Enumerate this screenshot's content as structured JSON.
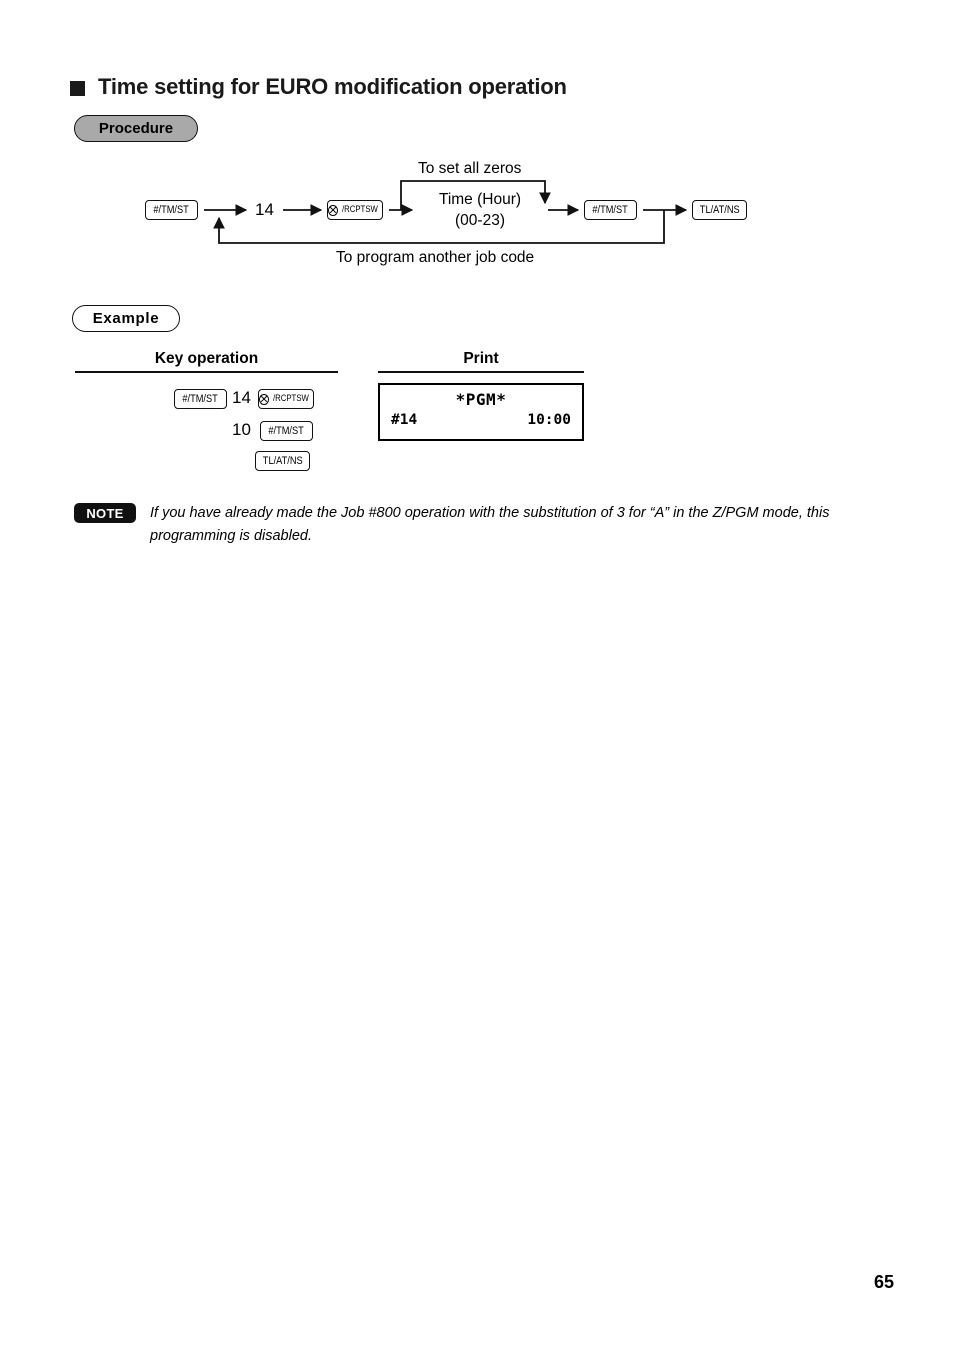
{
  "page": {
    "number": "65"
  },
  "section": {
    "title": "Time setting for EURO modification operation"
  },
  "badges": {
    "procedure": "Procedure",
    "example": "Example",
    "note": "NOTE"
  },
  "procedure_diagram": {
    "keys": {
      "hash_tm_st_1": "#/TM/ST",
      "rcptsw": "/RCPTSW",
      "hash_tm_st_2": "#/TM/ST",
      "tl_at_ns": "TL/AT/NS"
    },
    "job_code": "14",
    "value_box": {
      "line1": "Time (Hour)",
      "line2": "(00-23)"
    },
    "bypass_label": "To set all zeros",
    "loop_label": "To program another job code"
  },
  "example": {
    "headers": {
      "key_operation": "Key operation",
      "print": "Print"
    },
    "key_operation_rows": [
      {
        "key_left": "#/TM/ST",
        "number": "14",
        "key_right": "/RCPTSW"
      },
      {
        "number": "10",
        "key_right": "#/TM/ST"
      },
      {
        "key_right": "TL/AT/NS"
      }
    ],
    "receipt": {
      "header": "*PGM*",
      "job": "#14",
      "time": "10:00"
    }
  },
  "note": {
    "text": "If you have already made the Job #800 operation with the substitution of 3 for “A” in the Z/PGM mode, this programming is disabled."
  }
}
